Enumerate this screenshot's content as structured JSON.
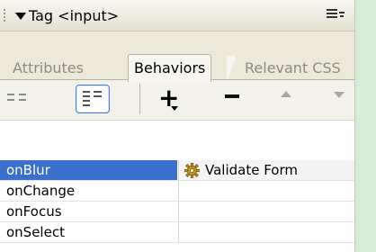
{
  "panel": {
    "title": "Tag <input>",
    "tabs": [
      {
        "label": "Attributes",
        "active": false
      },
      {
        "label": "Behaviors",
        "active": true
      },
      {
        "label": "Relevant CSS",
        "active": false
      }
    ],
    "toolbar": {
      "add_label": "+",
      "remove_label": "−"
    },
    "events": [
      {
        "event": "onBlur",
        "action": "Validate Form",
        "selected": true,
        "action_icon": "gear-icon"
      },
      {
        "event": "onChange",
        "action": ""
      },
      {
        "event": "onFocus",
        "action": ""
      },
      {
        "event": "onSelect",
        "action": ""
      }
    ]
  },
  "colors": {
    "selection": "#3a6fcb",
    "panel_bg": "#ece9d8",
    "page_bg": "#d6ecd6"
  }
}
